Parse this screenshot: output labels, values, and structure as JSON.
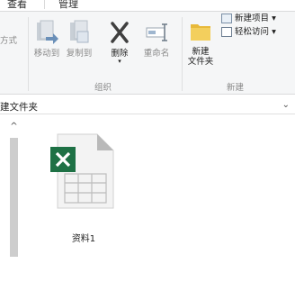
{
  "tabs": {
    "view": "查看",
    "manage": "管理"
  },
  "ribbon": {
    "left_cut": "方式",
    "organize": {
      "move_to": "移动到",
      "copy_to": "复制到",
      "delete": "删除",
      "rename": "重命名",
      "label": "组织"
    },
    "new": {
      "new_folder_line1": "新建",
      "new_folder_line2": "文件夹",
      "new_item": "新建项目",
      "easy_access": "轻松访问",
      "label": "新建"
    }
  },
  "address": {
    "path": "建文件夹"
  },
  "files": [
    {
      "name": "资料1",
      "type": "excel"
    }
  ],
  "colors": {
    "excel_green": "#1e7145",
    "folder_yellow": "#e8b93a",
    "scroll_thumb": "#cdcdcd"
  }
}
